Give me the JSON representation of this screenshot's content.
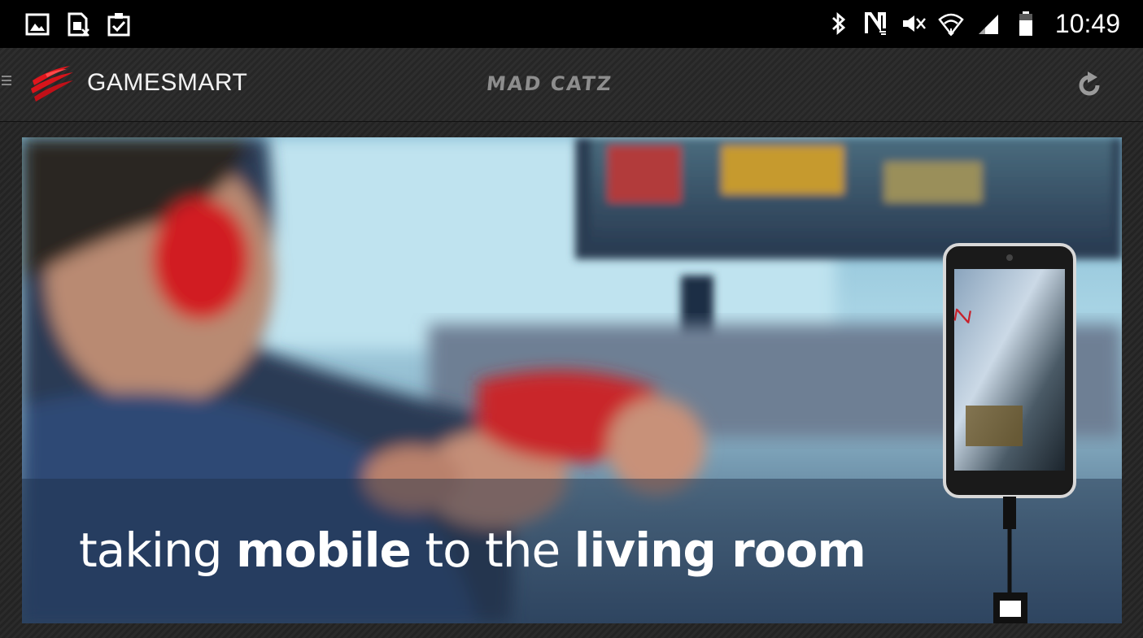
{
  "status_bar": {
    "time": "10:49",
    "icons": [
      "gallery-icon",
      "sim-card-icon",
      "clipboard-check-icon",
      "bluetooth-icon",
      "nfc-icon",
      "mute-icon",
      "wifi-icon",
      "signal-icon",
      "battery-icon"
    ]
  },
  "action_bar": {
    "title": "GAMESMART",
    "brand": "MAD CATZ",
    "icons": [
      "menu-icon",
      "mad-catz-logo",
      "refresh-icon"
    ]
  },
  "banner": {
    "caption_part1": "taking ",
    "caption_part2": "mobile",
    "caption_part3": " to the ",
    "caption_part4": "living room"
  },
  "colors": {
    "status_bar_bg": "#000000",
    "action_bar_bg": "#2a2a2a",
    "brand_red": "#d8141b",
    "brand_gray": "#8d8d8d"
  }
}
